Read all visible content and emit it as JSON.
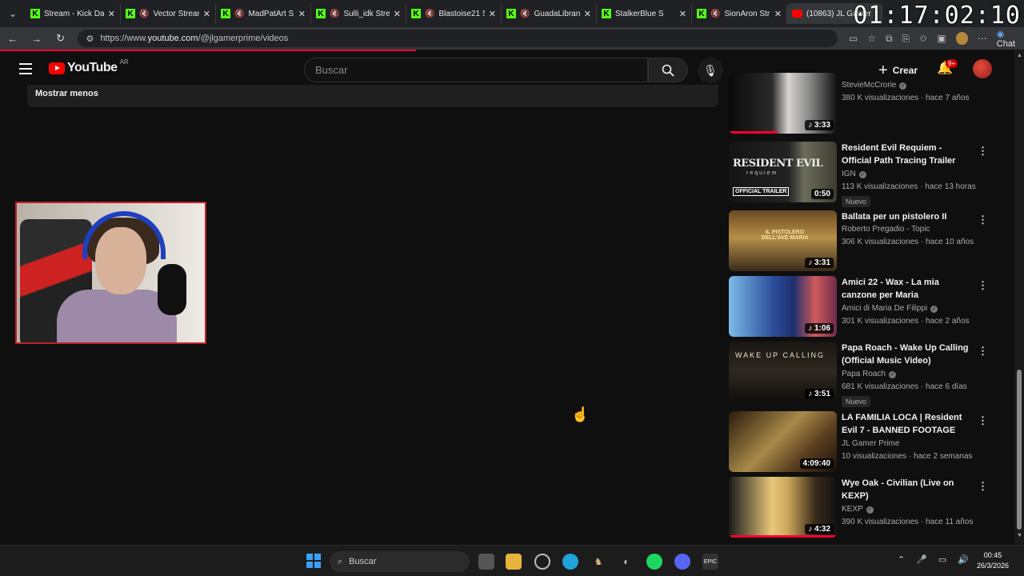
{
  "browser": {
    "tabs": [
      {
        "label": "Stream - Kick Da",
        "icon": "kick-icon",
        "muted": false
      },
      {
        "label": "Vector Strean",
        "icon": "kick-icon",
        "muted": true
      },
      {
        "label": "MadPatArt S",
        "icon": "kick-icon",
        "muted": true
      },
      {
        "label": "Sulli_idk Stre",
        "icon": "kick-icon",
        "muted": true
      },
      {
        "label": "Blastoise21 S",
        "icon": "kick-icon",
        "muted": true
      },
      {
        "label": "GuadaLibran",
        "icon": "kick-icon",
        "muted": true
      },
      {
        "label": "StalkerBlue S",
        "icon": "kick-icon",
        "muted": false
      },
      {
        "label": "SionAron Str",
        "icon": "kick-icon",
        "muted": true
      },
      {
        "label": "(10863) JL Gamer",
        "icon": "youtube-icon",
        "muted": false,
        "active": true
      }
    ],
    "url_prefix": "https://www.",
    "url_domain": "youtube.com",
    "url_path": "/@jlgamerprime/videos",
    "chat_label": "Chat",
    "overlay_clock": "01:17:02:10"
  },
  "youtube": {
    "logo_text": "YouTube",
    "country": "AR",
    "search_placeholder": "Buscar",
    "create_label": "Crear",
    "notif_badge": "9+",
    "show_less": "Mostrar menos"
  },
  "videos": [
    {
      "title": "",
      "channel": "StevieMcCrorie",
      "verified": true,
      "meta": "380 K visualizaciones · hace 7 años",
      "duration": "3:33",
      "music": true,
      "new": false,
      "watched": 0.45
    },
    {
      "title": "Resident Evil Requiem - Official Path Tracing Trailer",
      "channel": "IGN",
      "verified": true,
      "meta": "113 K visualizaciones · hace 13 horas",
      "duration": "0:50",
      "music": false,
      "new": true,
      "new_label": "Nuevo",
      "watched": 0
    },
    {
      "title": "Ballata per un pistolero II",
      "channel": "Roberto Pregadio - Topic",
      "verified": false,
      "meta": "306 K visualizaciones · hace 10 años",
      "duration": "3:31",
      "music": true,
      "new": false,
      "watched": 0
    },
    {
      "title": "Amici 22 - Wax - La mia canzone per Maria",
      "channel": "Amici di Maria De Filippi",
      "verified": true,
      "meta": "301 K visualizaciones · hace 2 años",
      "duration": "1:06",
      "music": true,
      "new": false,
      "watched": 0
    },
    {
      "title": "Papa Roach - Wake Up Calling (Official Music Video)",
      "channel": "Papa Roach",
      "verified": true,
      "meta": "681 K visualizaciones · hace 6 días",
      "duration": "3:51",
      "music": true,
      "new": true,
      "new_label": "Nuevo",
      "watched": 0
    },
    {
      "title": "LA FAMILIA LOCA | Resident Evil 7 - BANNED FOOTAGE",
      "channel": "JL Gamer Prime",
      "verified": false,
      "meta": "10 visualizaciones · hace 2 semanas",
      "duration": "4:09:40",
      "music": false,
      "new": false,
      "watched": 0
    },
    {
      "title": "Wye Oak - Civilian (Live on KEXP)",
      "channel": "KEXP",
      "verified": true,
      "meta": "390 K visualizaciones · hace 11 años",
      "duration": "4:32",
      "music": true,
      "new": false,
      "watched": 1
    }
  ],
  "thumb_text": {
    "re_title": "RESIDENT EVIL",
    "re_sub": "requiem",
    "re_badge": "OFFICIAL TRAILER",
    "ballata_text": "IL PISTOLERO DELL'AVE MARIA",
    "pr_text": "WAKE UP CALLING"
  },
  "taskbar": {
    "search_label": "Buscar",
    "time": "00:45",
    "date": "26/3/2026"
  },
  "colors": {
    "yt_red": "#ff0000",
    "progress": "#ff0033",
    "kick_green": "#53fc18",
    "webcam_border": "#c0202a"
  }
}
